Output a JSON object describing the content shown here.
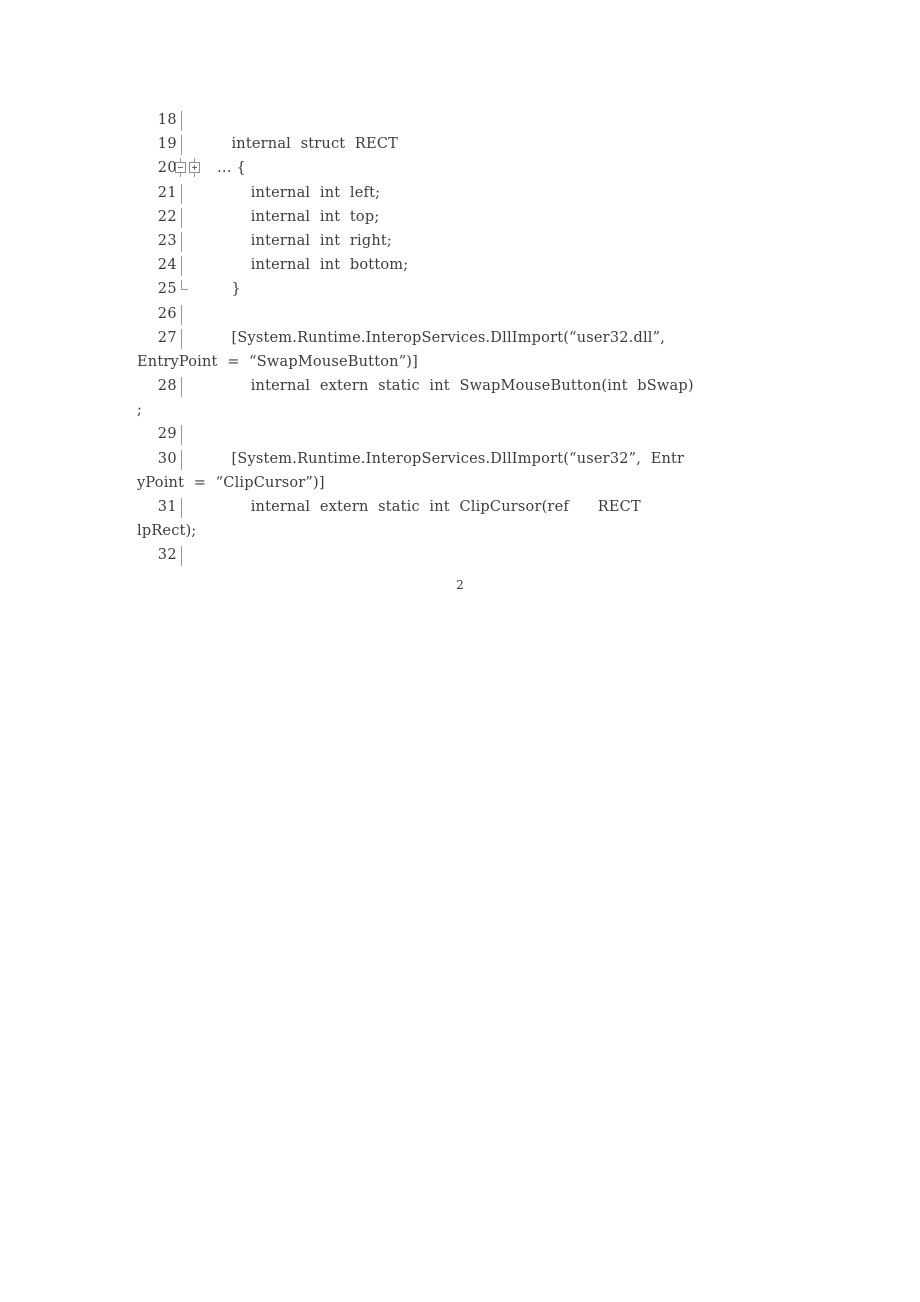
{
  "document": {
    "page_number": "2",
    "code_listing": {
      "lines": [
        {
          "number": "18",
          "marker": "bar",
          "text": ""
        },
        {
          "number": "19",
          "marker": "bar",
          "text": "        internal  struct  RECT"
        },
        {
          "number": "20",
          "marker": "foldboxes",
          "text": "     … {"
        },
        {
          "number": "21",
          "marker": "bar",
          "text": "            internal  int  left;"
        },
        {
          "number": "22",
          "marker": "bar",
          "text": "            internal  int  top;"
        },
        {
          "number": "23",
          "marker": "bar",
          "text": "            internal  int  right;"
        },
        {
          "number": "24",
          "marker": "bar",
          "text": "            internal  int  bottom;"
        },
        {
          "number": "25",
          "marker": "bar-end",
          "text": "        }"
        },
        {
          "number": "26",
          "marker": "bar",
          "text": ""
        },
        {
          "number": "27",
          "marker": "bar",
          "text": "        [System.Runtime.InteropServices.DllImport(“user32.dll”,"
        },
        {
          "number": "28",
          "marker": "bar",
          "text": "            internal  extern  static  int  SwapMouseButton(int  bSwap)"
        },
        {
          "number": "29",
          "marker": "bar",
          "text": ""
        },
        {
          "number": "30",
          "marker": "bar",
          "text": "        [System.Runtime.InteropServices.DllImport(“user32”,  Entr"
        },
        {
          "number": "31",
          "marker": "bar",
          "text": "            internal  extern  static  int  ClipCursor(ref      RECT"
        },
        {
          "number": "32",
          "marker": "bar",
          "text": ""
        }
      ],
      "wrapped_continuations": {
        "after_line_27": "EntryPoint  =  “SwapMouseButton”)]",
        "after_line_28": ";",
        "after_line_30": "yPoint  =  “ClipCursor”)]",
        "after_line_31": "lpRect);"
      }
    }
  },
  "colors": {
    "page_background": "#ffffff",
    "text": "#3c3c3c",
    "gutter_text": "#3a3a3a",
    "fold_marker": "#9a9a9a"
  }
}
